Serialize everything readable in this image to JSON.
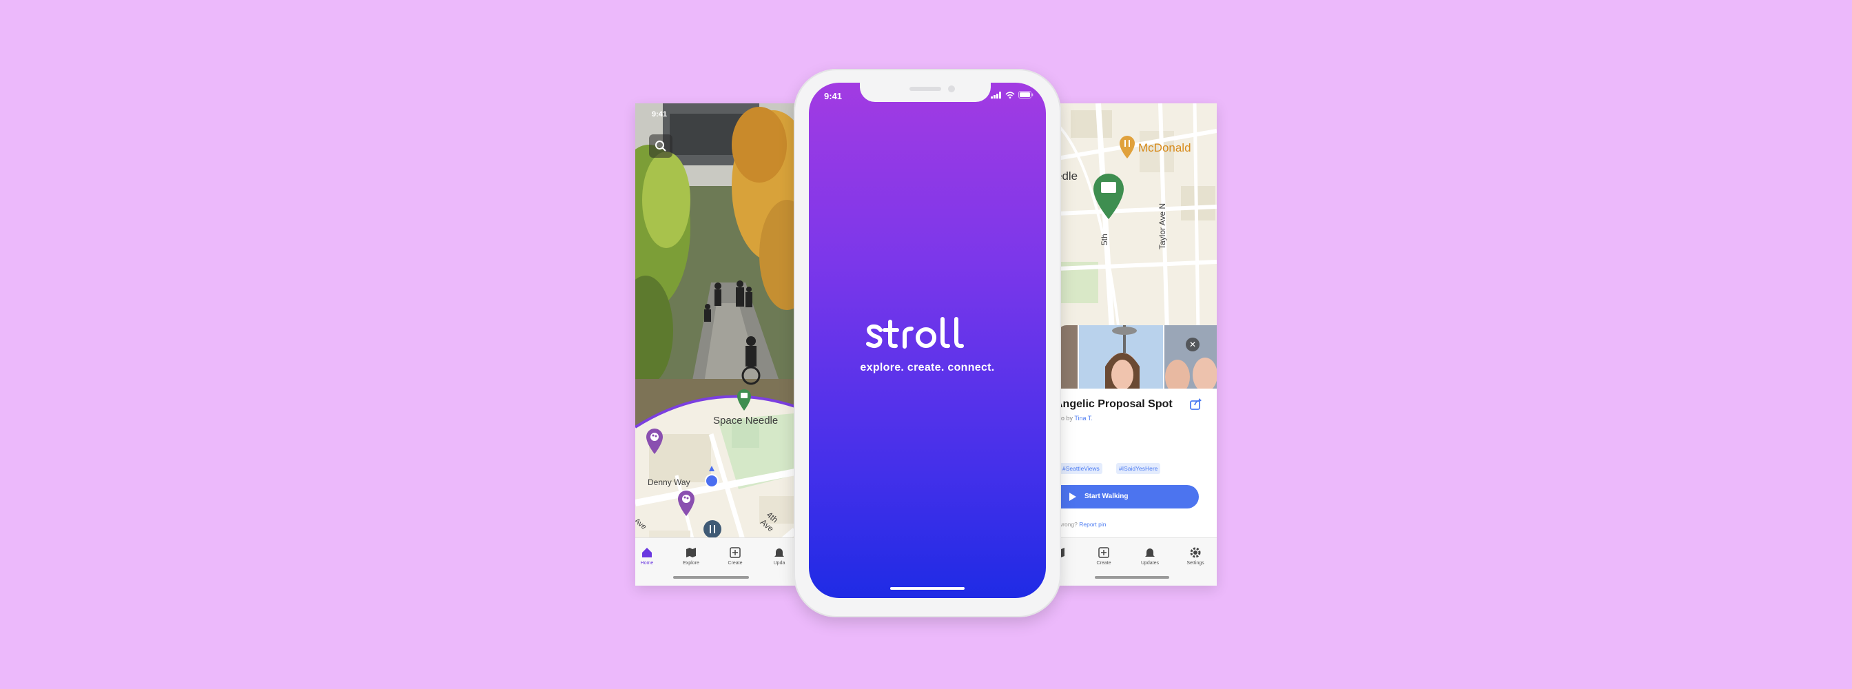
{
  "left_screen": {
    "status_time": "9:41",
    "map": {
      "landmark": "Space Needle",
      "street_1": "Denny Way",
      "street_2": "4th Ave",
      "street_3": "Ave"
    },
    "tabs": [
      {
        "label": "Home",
        "icon": "home-icon",
        "active": true
      },
      {
        "label": "Explore",
        "icon": "map-icon"
      },
      {
        "label": "Create",
        "icon": "plus-square-icon"
      },
      {
        "label": "Upda",
        "icon": "bell-icon"
      }
    ]
  },
  "center_screen": {
    "status_time": "9:41",
    "logo_text": "stroll",
    "tagline": "explore. create. connect."
  },
  "right_screen": {
    "map": {
      "place": "McDonald",
      "landmark_fragment": "edle",
      "street_1": "5th",
      "street_2": "Taylor Ave N"
    },
    "spot": {
      "title": "Angelic Proposal Spot",
      "meta_prefix": "ago by ",
      "author": "Tina T.",
      "tags": [
        "#SeattleViews",
        "#ISaidYesHere"
      ],
      "button_label": "Start Walking",
      "report_prefix": "wrong? ",
      "report_link": "Report pin",
      "close_symbol": "✕"
    },
    "tabs": [
      {
        "label": "e",
        "icon": "map-icon"
      },
      {
        "label": "Create",
        "icon": "plus-square-icon"
      },
      {
        "label": "Updates",
        "icon": "bell-icon"
      },
      {
        "label": "Settings",
        "icon": "gear-icon"
      }
    ]
  },
  "colors": {
    "background": "#ecb9fb",
    "brand_purple": "#a23be2",
    "brand_blue": "#1f2be5",
    "accent_blue": "#4c74ef",
    "pin_purple": "#8a4fb0",
    "pin_green": "#3e8e50"
  }
}
